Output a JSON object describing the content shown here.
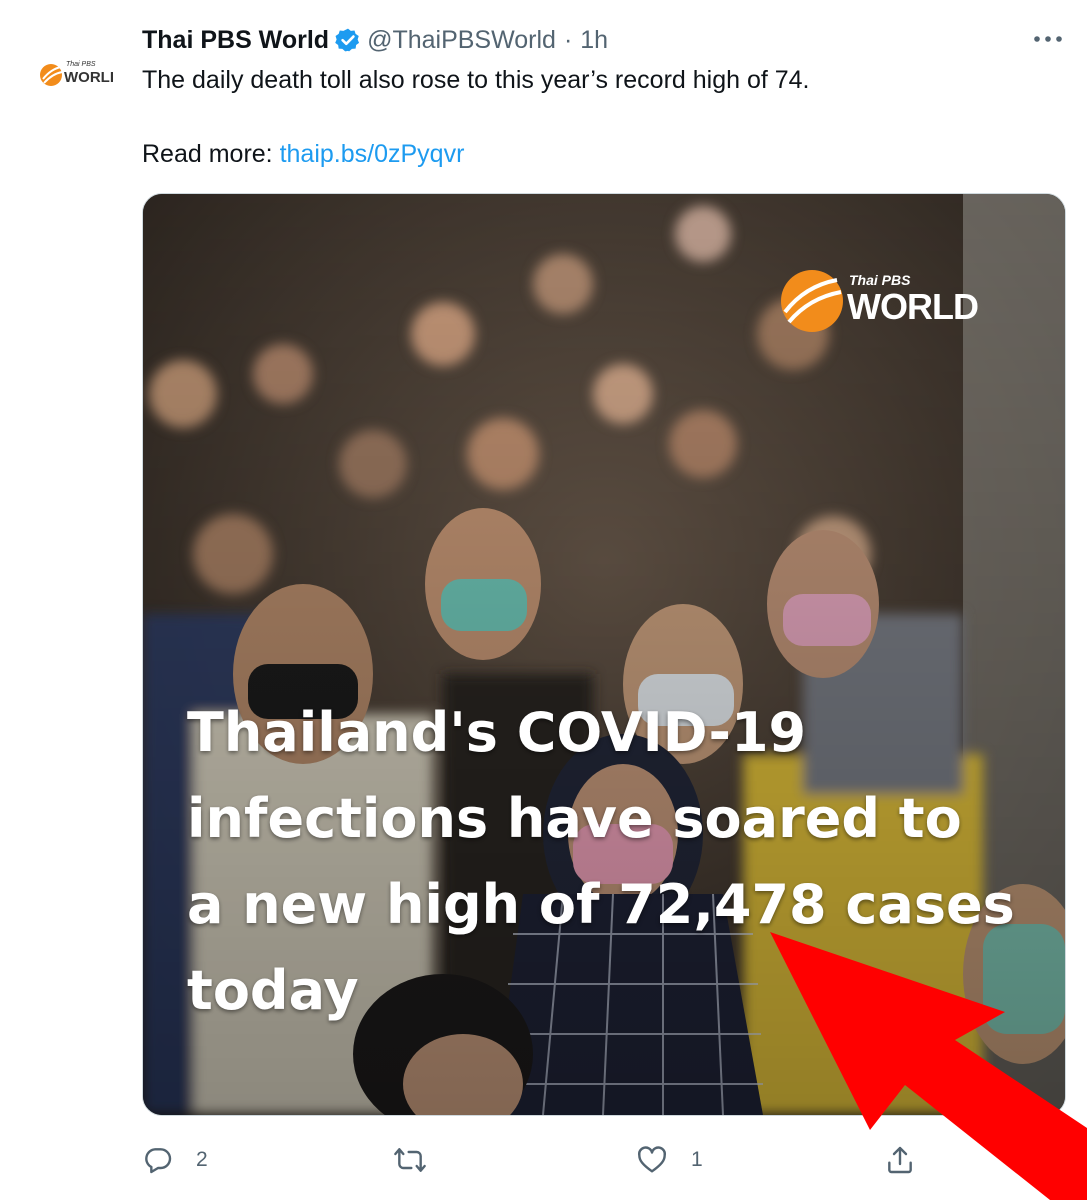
{
  "tweet": {
    "author_name": "Thai PBS World",
    "handle": "@ThaiPBSWorld",
    "separator": "·",
    "time": "1h",
    "text_line1": "The daily death toll also rose to this year’s record high of 74.",
    "read_more_label": "Read more:",
    "link_text": "thaip.bs/0zPyqvr"
  },
  "avatar": {
    "logo_small": "Thai PBS",
    "logo_big": "WORLD"
  },
  "media": {
    "brand_small": "Thai PBS",
    "brand_big": "WORLD",
    "headline_line1": "Thailand's COVID-19",
    "headline_line2": "infections have soared to",
    "headline_line3": "a new high of 72,478 cases",
    "headline_line4": "today"
  },
  "actions": {
    "reply_count": "2",
    "retweet_count": "",
    "like_count": "1"
  },
  "colors": {
    "link": "#1d9bf0",
    "verified": "#1d9bf0",
    "secondary_text": "#536471",
    "annotation_arrow": "#ff0000",
    "brand_orange": "#f28c1b"
  }
}
